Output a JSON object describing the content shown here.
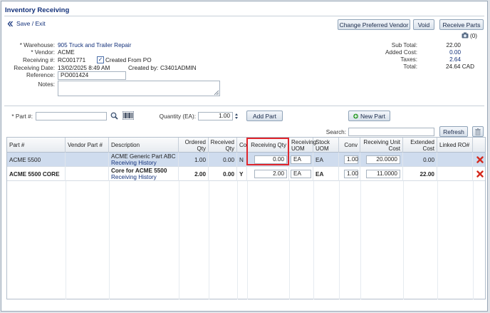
{
  "window": {
    "title": "Inventory Receiving"
  },
  "toolbar": {
    "save_exit": "Save / Exit",
    "change_vendor": "Change Preferred Vendor",
    "void": "Void",
    "receive_parts": "Receive Parts",
    "attachments_count": "(0)"
  },
  "header": {
    "warehouse_label": "* Warehouse:",
    "warehouse_value": "905 Truck and Trailer Repair",
    "vendor_label": "* Vendor:",
    "vendor_value": "ACME",
    "receiving_no_label": "Receiving #:",
    "receiving_no_value": "RC001771",
    "created_from_po": "Created From PO",
    "receiving_date_label": "Receiving Date:",
    "receiving_date_value": "13/02/2025 8:49 AM",
    "created_by_label": "Created by:",
    "created_by_value": "C3401ADMIN",
    "reference_label": "Reference:",
    "reference_value": "PO001424",
    "notes_label": "Notes:",
    "notes_value": ""
  },
  "totals": {
    "sub_total_label": "Sub Total:",
    "sub_total_value": "22.00",
    "added_cost_label": "Added Cost:",
    "added_cost_value": "0.00",
    "taxes_label": "Taxes:",
    "taxes_value": "2.64",
    "total_label": "Total:",
    "total_value": "24.64 CAD"
  },
  "part_entry": {
    "part_label": "* Part #:",
    "part_value": "",
    "quantity_label": "Quantity (EA):",
    "quantity_value": "1.00",
    "add_part": "Add Part",
    "new_part": "New Part"
  },
  "grid": {
    "search_label": "Search:",
    "search_value": "",
    "refresh": "Refresh",
    "columns": {
      "part": "Part #",
      "vendor_part": "Vendor Part #",
      "description": "Description",
      "ordered_qty": "Ordered Qty",
      "received_qty": "Received Qty",
      "core": "Core",
      "receiving_qty": "Receiving Qty",
      "receiving_uom": "Receiving UOM",
      "stock_uom": "Stock UOM",
      "conv": "Conv",
      "receiving_unit_cost": "Receiving Unit Cost",
      "extended_cost": "Extended Cost",
      "linked_ro": "Linked RO#"
    },
    "rows": [
      {
        "part": "ACME 5500",
        "vendor_part": "",
        "description": "ACME Generic Part ABC",
        "history_link": "Receiving History",
        "ordered_qty": "1.00",
        "received_qty": "0.00",
        "core": "N",
        "receiving_qty": "0.00",
        "receiving_uom": "EA",
        "stock_uom": "EA",
        "conv": "1.00",
        "receiving_unit_cost": "20.0000",
        "extended_cost": "0.00",
        "linked_ro": ""
      },
      {
        "part": "ACME 5500 CORE",
        "vendor_part": "",
        "description": "Core for ACME 5500",
        "history_link": "Receiving History",
        "ordered_qty": "2.00",
        "received_qty": "0.00",
        "core": "Y",
        "receiving_qty": "2.00",
        "receiving_uom": "EA",
        "stock_uom": "EA",
        "conv": "1.00",
        "receiving_unit_cost": "11.0000",
        "extended_cost": "22.00",
        "linked_ro": ""
      }
    ]
  },
  "colors": {
    "accent": "#12307a",
    "highlight": "#e0252c",
    "selected_row": "#cfdcee",
    "new_part_plus": "#2e9b2e",
    "delete_x": "#d42a1e"
  }
}
